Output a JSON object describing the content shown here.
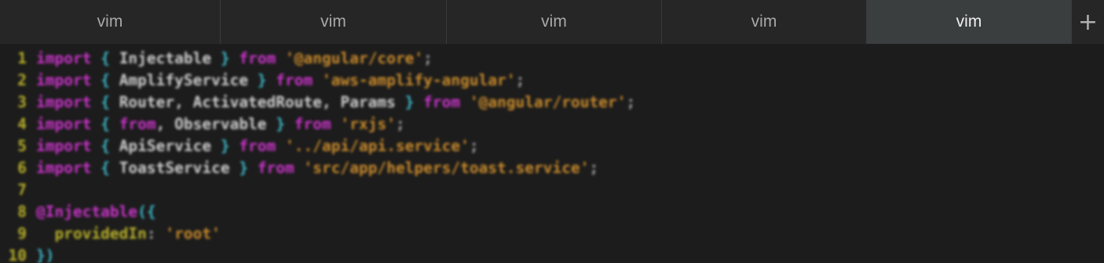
{
  "tabs": [
    {
      "label": "vim",
      "active": false
    },
    {
      "label": "vim",
      "active": false
    },
    {
      "label": "vim",
      "active": false
    },
    {
      "label": "vim",
      "active": false
    },
    {
      "label": "vim",
      "active": true
    }
  ],
  "new_tab_symbol": "+",
  "code": {
    "lines": [
      {
        "num": "1",
        "t": [
          [
            "kw",
            "import"
          ],
          [
            "pl",
            " "
          ],
          [
            "br",
            "{"
          ],
          [
            "id",
            " Injectable "
          ],
          [
            "br",
            "}"
          ],
          [
            "pl",
            " "
          ],
          [
            "kw",
            "from"
          ],
          [
            "pl",
            " "
          ],
          [
            "str",
            "'@angular/core'"
          ],
          [
            "pl",
            ";"
          ]
        ]
      },
      {
        "num": "2",
        "t": [
          [
            "kw",
            "import"
          ],
          [
            "pl",
            " "
          ],
          [
            "br",
            "{"
          ],
          [
            "id",
            " AmplifyService "
          ],
          [
            "br",
            "}"
          ],
          [
            "pl",
            " "
          ],
          [
            "kw",
            "from"
          ],
          [
            "pl",
            " "
          ],
          [
            "str",
            "'aws-amplify-angular'"
          ],
          [
            "pl",
            ";"
          ]
        ]
      },
      {
        "num": "3",
        "t": [
          [
            "kw",
            "import"
          ],
          [
            "pl",
            " "
          ],
          [
            "br",
            "{"
          ],
          [
            "id",
            " Router, ActivatedRoute, Params "
          ],
          [
            "br",
            "}"
          ],
          [
            "pl",
            " "
          ],
          [
            "kw",
            "from"
          ],
          [
            "pl",
            " "
          ],
          [
            "str",
            "'@angular/router'"
          ],
          [
            "pl",
            ";"
          ]
        ]
      },
      {
        "num": "4",
        "t": [
          [
            "kw",
            "import"
          ],
          [
            "pl",
            " "
          ],
          [
            "br",
            "{"
          ],
          [
            "pl",
            " "
          ],
          [
            "kw",
            "from"
          ],
          [
            "id",
            ", Observable "
          ],
          [
            "br",
            "}"
          ],
          [
            "pl",
            " "
          ],
          [
            "kw",
            "from"
          ],
          [
            "pl",
            " "
          ],
          [
            "str",
            "'rxjs'"
          ],
          [
            "pl",
            ";"
          ]
        ]
      },
      {
        "num": "5",
        "t": [
          [
            "kw",
            "import"
          ],
          [
            "pl",
            " "
          ],
          [
            "br",
            "{"
          ],
          [
            "id",
            " ApiService "
          ],
          [
            "br",
            "}"
          ],
          [
            "pl",
            " "
          ],
          [
            "kw",
            "from"
          ],
          [
            "pl",
            " "
          ],
          [
            "str",
            "'../api/api.service'"
          ],
          [
            "pl",
            ";"
          ]
        ]
      },
      {
        "num": "6",
        "t": [
          [
            "kw",
            "import"
          ],
          [
            "pl",
            " "
          ],
          [
            "br",
            "{"
          ],
          [
            "id",
            " ToastService "
          ],
          [
            "br",
            "}"
          ],
          [
            "pl",
            " "
          ],
          [
            "kw",
            "from"
          ],
          [
            "pl",
            " "
          ],
          [
            "str",
            "'src/app/helpers/toast.service'"
          ],
          [
            "pl",
            ";"
          ]
        ]
      },
      {
        "num": "7",
        "t": []
      },
      {
        "num": "8",
        "t": [
          [
            "dec",
            "@Injectable"
          ],
          [
            "br",
            "({"
          ]
        ]
      },
      {
        "num": "9",
        "t": [
          [
            "pl",
            "  "
          ],
          [
            "prop",
            "providedIn"
          ],
          [
            "pl",
            ": "
          ],
          [
            "str",
            "'root'"
          ]
        ]
      },
      {
        "num": "10",
        "t": [
          [
            "br",
            "})"
          ]
        ]
      }
    ]
  },
  "colors": {
    "keyword": "#c934c9",
    "brace": "#3cb7c7",
    "identifier": "#cfcfcf",
    "string": "#c88a2c",
    "line_number": "#b8b02a"
  }
}
